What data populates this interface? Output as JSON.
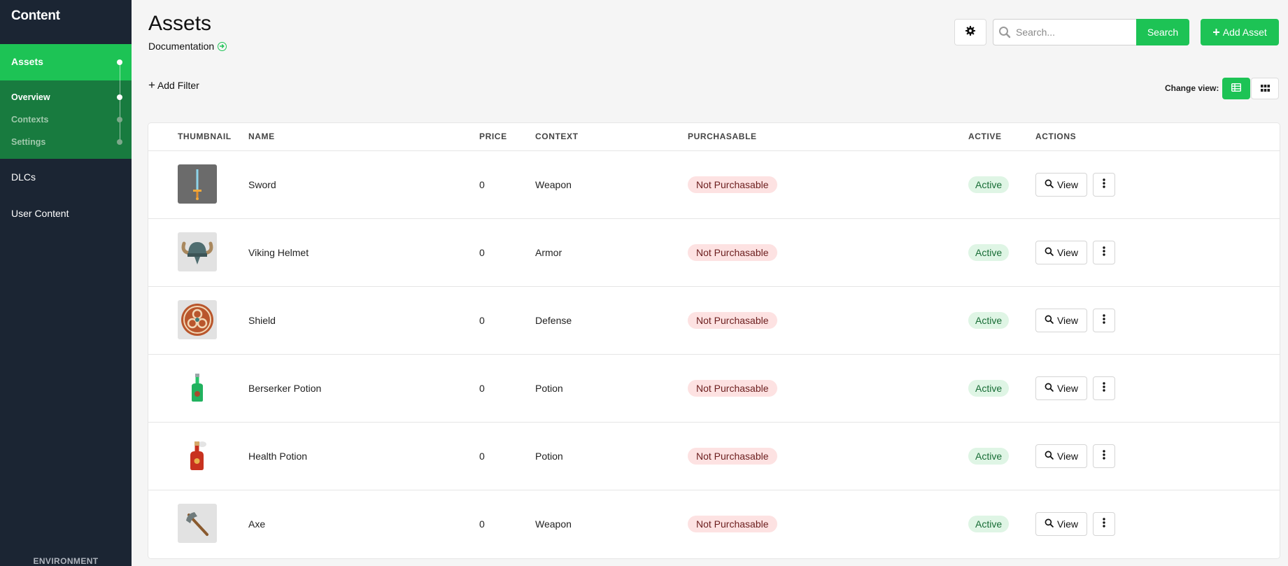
{
  "sidebar": {
    "title": "Content",
    "assets_label": "Assets",
    "sub_items": [
      {
        "label": "Overview"
      },
      {
        "label": "Contexts"
      },
      {
        "label": "Settings"
      }
    ],
    "items": [
      {
        "label": "DLCs"
      },
      {
        "label": "User Content"
      }
    ],
    "environment_label": "ENVIRONMENT"
  },
  "header": {
    "title": "Assets",
    "doc_link": "Documentation",
    "search_placeholder": "Search...",
    "search_button": "Search",
    "add_asset_button": "Add Asset"
  },
  "toolbar": {
    "add_filter": "Add Filter",
    "change_view_label": "Change view:"
  },
  "table": {
    "columns": [
      "THUMBNAIL",
      "NAME",
      "PRICE",
      "CONTEXT",
      "PURCHASABLE",
      "ACTIVE",
      "ACTIONS"
    ],
    "view_label": "View",
    "rows": [
      {
        "name": "Sword",
        "price": "0",
        "context": "Weapon",
        "purchasable": "Not Purchasable",
        "active": "Active",
        "thumbnail_icon": "sword-icon"
      },
      {
        "name": "Viking Helmet",
        "price": "0",
        "context": "Armor",
        "purchasable": "Not Purchasable",
        "active": "Active",
        "thumbnail_icon": "viking-helmet-icon"
      },
      {
        "name": "Shield",
        "price": "0",
        "context": "Defense",
        "purchasable": "Not Purchasable",
        "active": "Active",
        "thumbnail_icon": "shield-icon"
      },
      {
        "name": "Berserker Potion",
        "price": "0",
        "context": "Potion",
        "purchasable": "Not Purchasable",
        "active": "Active",
        "thumbnail_icon": "green-potion-icon"
      },
      {
        "name": "Health Potion",
        "price": "0",
        "context": "Potion",
        "purchasable": "Not Purchasable",
        "active": "Active",
        "thumbnail_icon": "red-potion-icon"
      },
      {
        "name": "Axe",
        "price": "0",
        "context": "Weapon",
        "purchasable": "Not Purchasable",
        "active": "Active",
        "thumbnail_icon": "axe-icon"
      }
    ]
  },
  "colors": {
    "accent": "#1dc355",
    "sidebar_bg": "#1b2533",
    "sidebar_sub_bg": "#187b3f",
    "badge_not_purchasable_bg": "#fde2e2",
    "badge_active_bg": "#dff5e5"
  }
}
